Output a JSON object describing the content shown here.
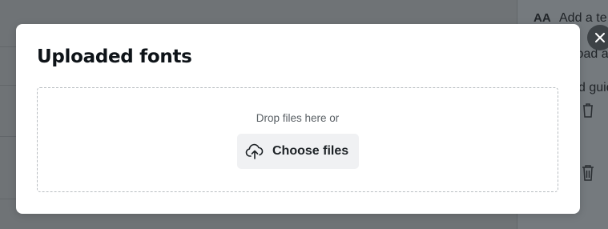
{
  "modal": {
    "title": "Uploaded fonts",
    "drop_text": "Drop files here or",
    "choose_files_label": "Choose files",
    "upload_icon": "cloud-upload-icon",
    "close_icon": "close-icon"
  },
  "background_panel": {
    "text_icon": "text-size-icon",
    "text_icon_glyph": "AA",
    "item_add_text": "Add a te",
    "item_upload": "load a",
    "item_guide": "d guid",
    "trash_icon": "trash-icon"
  },
  "colors": {
    "overlay": "#6f7376",
    "modal_background": "#ffffff",
    "button_background": "#f0f1f3",
    "close_button": "#3d4246",
    "title_text": "#0e1318"
  }
}
